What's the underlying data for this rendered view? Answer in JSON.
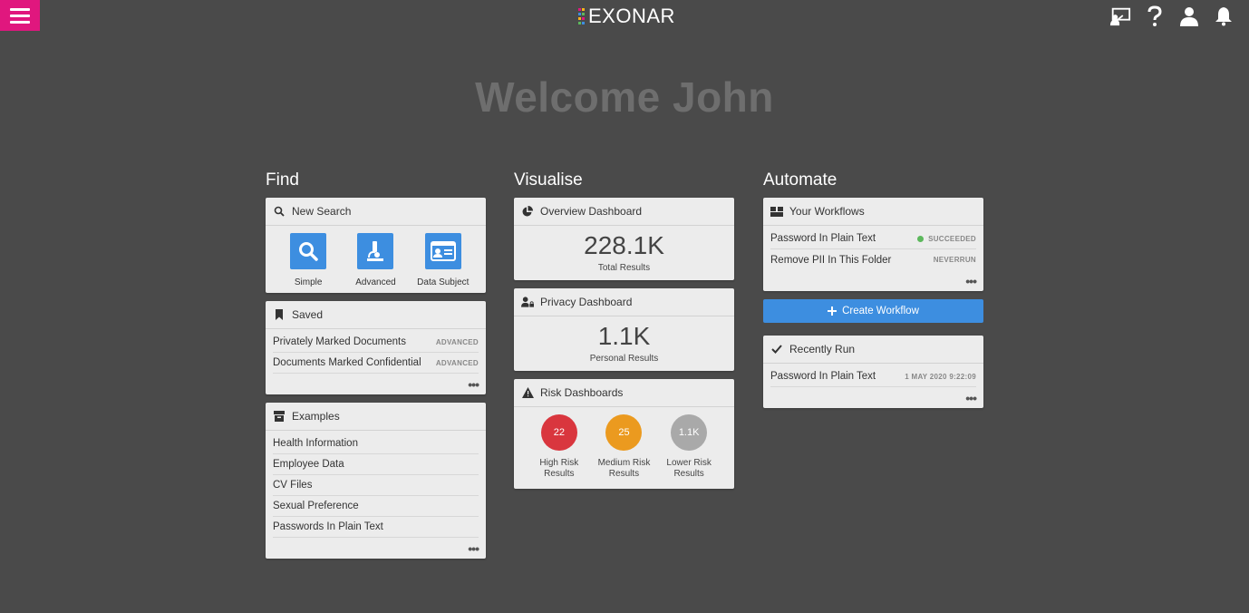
{
  "header": {
    "logo_text": "EXONAR",
    "icons": [
      "menu-icon",
      "presentation-icon",
      "help-icon",
      "user-icon",
      "bell-icon"
    ],
    "brand_color": "#e0177e"
  },
  "welcome": "Welcome John",
  "find": {
    "title": "Find",
    "new_search": {
      "title": "New Search",
      "types": [
        {
          "label": "Simple",
          "icon": "magnifier-icon"
        },
        {
          "label": "Advanced",
          "icon": "microscope-icon"
        },
        {
          "label": "Data Subject",
          "icon": "id-card-icon"
        }
      ]
    },
    "saved": {
      "title": "Saved",
      "items": [
        {
          "label": "Privately Marked Documents",
          "tag": "ADVANCED"
        },
        {
          "label": "Documents Marked Confidential",
          "tag": "ADVANCED"
        }
      ],
      "more": "•••"
    },
    "examples": {
      "title": "Examples",
      "items": [
        "Health Information",
        "Employee Data",
        "CV Files",
        "Sexual Preference",
        "Passwords In Plain Text"
      ],
      "more": "•••"
    }
  },
  "visualise": {
    "title": "Visualise",
    "overview": {
      "title": "Overview Dashboard",
      "value": "228.1K",
      "label": "Total Results"
    },
    "privacy": {
      "title": "Privacy Dashboard",
      "value": "1.1K",
      "label": "Personal Results"
    },
    "risk": {
      "title": "Risk Dashboards",
      "items": [
        {
          "value": "22",
          "label1": "High Risk",
          "label2": "Results",
          "color": "#d9363e"
        },
        {
          "value": "25",
          "label1": "Medium Risk",
          "label2": "Results",
          "color": "#eb9a1f"
        },
        {
          "value": "1.1K",
          "label1": "Lower Risk",
          "label2": "Results",
          "color": "#a9a9a9"
        }
      ]
    }
  },
  "automate": {
    "title": "Automate",
    "workflows": {
      "title": "Your Workflows",
      "items": [
        {
          "label": "Password In Plain Text",
          "status": "SUCCEEDED"
        },
        {
          "label": "Remove PII In This Folder",
          "status": "NEVERRUN"
        }
      ],
      "more": "•••"
    },
    "create_label": "Create Workflow",
    "recent": {
      "title": "Recently Run",
      "items": [
        {
          "label": "Password In Plain Text",
          "time": "1 MAY 2020 9:22:09"
        }
      ],
      "more": "•••"
    }
  }
}
